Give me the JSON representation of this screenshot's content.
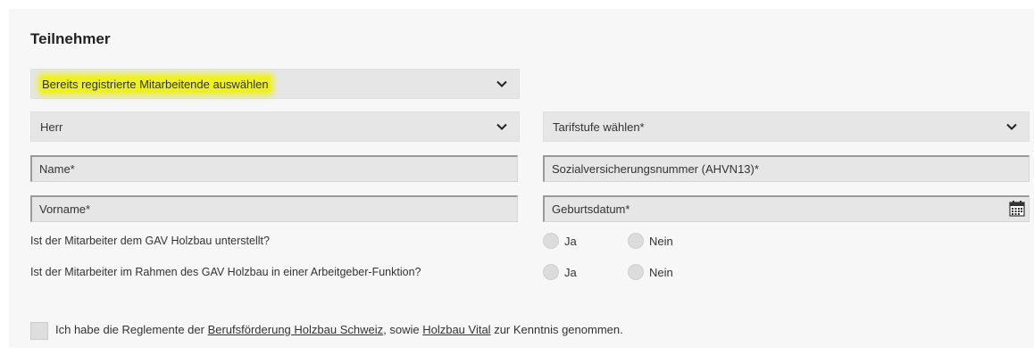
{
  "section": {
    "title": "Teilnehmer"
  },
  "employee_select": {
    "value": "Bereits registrierte Mitarbeitende auswählen",
    "highlight_color": "#eef020"
  },
  "salutation_select": {
    "value": "Herr"
  },
  "tariff_select": {
    "value": "Tarifstufe wählen*"
  },
  "fields": {
    "name_placeholder": "Name*",
    "firstname_placeholder": "Vorname*",
    "ahv_placeholder": "Sozialversicherungsnummer (AHVN13)*",
    "birthdate_placeholder": "Geburtsdatum*"
  },
  "questions": [
    {
      "text": "Ist der Mitarbeiter dem GAV Holzbau unterstellt?",
      "yes": "Ja",
      "no": "Nein"
    },
    {
      "text": "Ist der Mitarbeiter im Rahmen des GAV Holzbau in einer Arbeitgeber-Funktion?",
      "yes": "Ja",
      "no": "Nein"
    }
  ],
  "acknowledgement": {
    "prefix": "Ich habe die Reglemente der ",
    "link1": "Berufsförderung Holzbau Schweiz",
    "middle": ", sowie ",
    "link2": "Holzbau Vital",
    "suffix": " zur Kenntnis genommen."
  },
  "icons": {
    "dropdown": "chevron-down-icon",
    "calendar": "calendar-icon"
  }
}
